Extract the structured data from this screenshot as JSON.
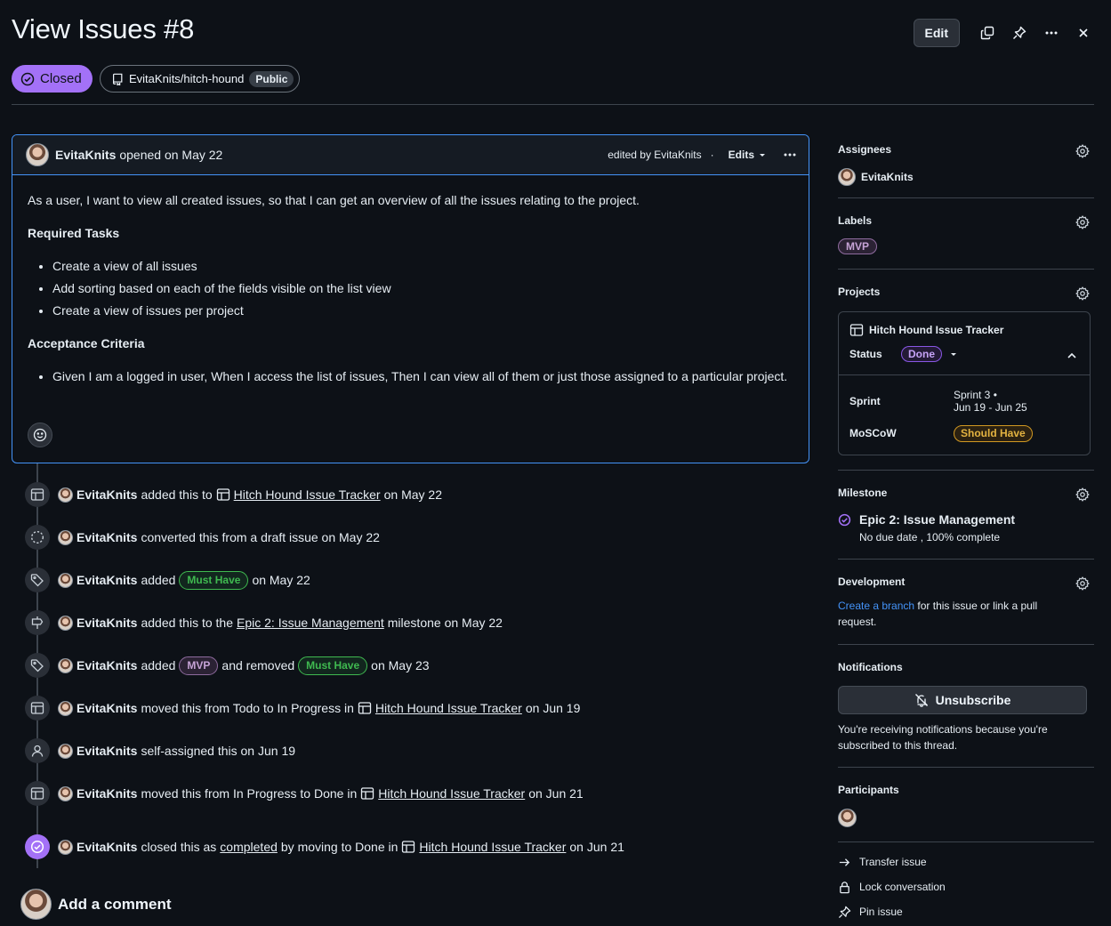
{
  "header": {
    "title": "View Issues #8",
    "edit_label": "Edit",
    "state_label": "Closed",
    "repo": "EvitaKnits/hitch-hound",
    "visibility": "Public"
  },
  "comment": {
    "author": "EvitaKnits",
    "opened_text": "opened on May 22",
    "edited_by": "edited by EvitaKnits",
    "edits_label": "Edits",
    "intro": "As a user, I want to view all created issues, so that I can get an overview of all the issues relating to the project.",
    "tasks_heading": "Required Tasks",
    "tasks": [
      "Create a view of all issues",
      "Add sorting based on each of the fields visible on the list view",
      "Create a view of issues per project"
    ],
    "criteria_heading": "Acceptance Criteria",
    "criteria": [
      "Given I am a logged in user, When I access the list of issues, Then I can view all of them or just those assigned to a particular project."
    ]
  },
  "timeline": {
    "e1": {
      "author": "EvitaKnits",
      "pre": "added this to",
      "link": "Hitch Hound Issue Tracker",
      "post": "on May 22"
    },
    "e2": {
      "author": "EvitaKnits",
      "text": "converted this from a draft issue on May 22"
    },
    "e3": {
      "author": "EvitaKnits",
      "pre": "added",
      "label": "Must Have",
      "post": "on May 22"
    },
    "e4": {
      "author": "EvitaKnits",
      "pre": "added this to the",
      "link": "Epic 2: Issue Management",
      "post": "milestone on May 22"
    },
    "e5": {
      "author": "EvitaKnits",
      "pre": "added",
      "label1": "MVP",
      "mid": "and removed",
      "label2": "Must Have",
      "post": "on May 23"
    },
    "e6": {
      "author": "EvitaKnits",
      "pre": "moved this from Todo to In Progress in",
      "link": "Hitch Hound Issue Tracker",
      "post": "on Jun 19"
    },
    "e7": {
      "author": "EvitaKnits",
      "text": "self-assigned this on Jun 19"
    },
    "e8": {
      "author": "EvitaKnits",
      "pre": "moved this from In Progress to Done in",
      "link": "Hitch Hound Issue Tracker",
      "post": "on Jun 21"
    },
    "e9": {
      "author": "EvitaKnits",
      "pre": "closed this as",
      "link1": "completed",
      "mid": "by moving to Done in",
      "link": "Hitch Hound Issue Tracker",
      "post": "on Jun 21"
    }
  },
  "add_comment": "Add a comment",
  "sidebar": {
    "assignees": {
      "heading": "Assignees",
      "name": "EvitaKnits"
    },
    "labels": {
      "heading": "Labels",
      "label": "MVP"
    },
    "projects": {
      "heading": "Projects",
      "name": "Hitch Hound Issue Tracker",
      "status_key": "Status",
      "status_value": "Done",
      "sprint_key": "Sprint",
      "sprint_line1": "Sprint 3 •",
      "sprint_line2": "Jun 19 - Jun 25",
      "moscow_key": "MoSCoW",
      "moscow_value": "Should Have"
    },
    "milestone": {
      "heading": "Milestone",
      "title": "Epic 2: Issue Management",
      "sub": "No due date , 100% complete"
    },
    "development": {
      "heading": "Development",
      "link": "Create a branch",
      "text": "for this issue or link a pull",
      "text2": "request."
    },
    "notifications": {
      "heading": "Notifications",
      "button": "Unsubscribe",
      "note": "You're receiving notifications because you're subscribed to this thread."
    },
    "participants": {
      "heading": "Participants"
    },
    "actions": [
      "Transfer issue",
      "Lock conversation",
      "Pin issue"
    ]
  },
  "colors": {
    "accent_purple": "#a371f7",
    "link_blue": "#4493f8",
    "label_green": "#3fb950",
    "label_yellow": "#d29922",
    "bg": "#0d1117"
  }
}
